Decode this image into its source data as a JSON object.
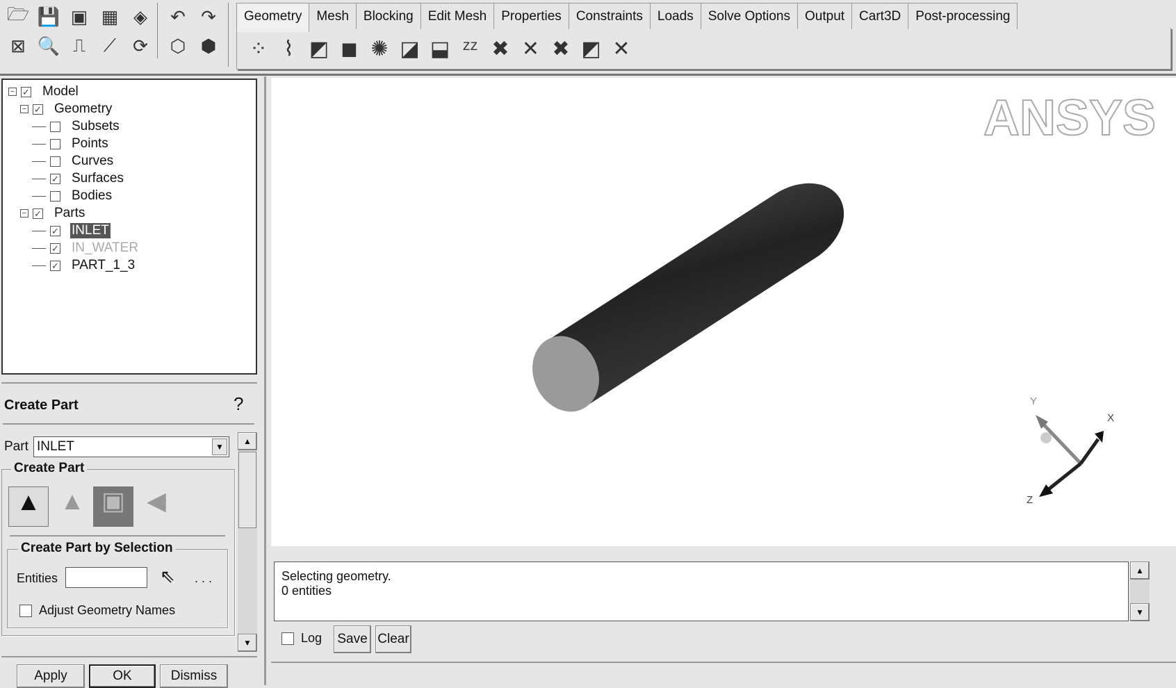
{
  "toolbar": {
    "icons_row1": [
      "open-icon",
      "save-icon",
      "save-as-icon",
      "save-project-icon",
      "import-icon",
      "undo-icon",
      "redo-icon"
    ],
    "icons_row2": [
      "fit-window-icon",
      "zoom-box-icon",
      "measure-icon",
      "coordinate-system-icon",
      "refresh-icon",
      "wireframe-icon",
      "solid-icon"
    ]
  },
  "tabs": [
    {
      "label": "Geometry",
      "active": true
    },
    {
      "label": "Mesh"
    },
    {
      "label": "Blocking"
    },
    {
      "label": "Edit Mesh"
    },
    {
      "label": "Properties"
    },
    {
      "label": "Constraints"
    },
    {
      "label": "Loads"
    },
    {
      "label": "Solve Options"
    },
    {
      "label": "Output"
    },
    {
      "label": "Cart3D"
    },
    {
      "label": "Post-processing"
    }
  ],
  "ribbon_icons": [
    "create-point-icon",
    "create-curve-icon",
    "create-surface-icon",
    "create-body-icon",
    "repair-geometry-icon",
    "transform-geometry-icon",
    "surface-operations-icon",
    "zzz-icon",
    "delete-point-icon",
    "delete-curve-icon",
    "delete-surface-icon",
    "delete-body-icon",
    "delete-any-icon"
  ],
  "tree": {
    "items": [
      {
        "label": "Model",
        "level": 0,
        "checked": true,
        "expand": true
      },
      {
        "label": "Geometry",
        "level": 1,
        "checked": true,
        "expand": true
      },
      {
        "label": "Subsets",
        "level": 2,
        "checked": false
      },
      {
        "label": "Points",
        "level": 2,
        "checked": false
      },
      {
        "label": "Curves",
        "level": 2,
        "checked": false
      },
      {
        "label": "Surfaces",
        "level": 2,
        "checked": true
      },
      {
        "label": "Bodies",
        "level": 2,
        "checked": false
      },
      {
        "label": "Parts",
        "level": 1,
        "checked": true,
        "expand": true
      },
      {
        "label": "INLET",
        "level": 2,
        "checked": true,
        "selected": true
      },
      {
        "label": "IN_WATER",
        "level": 2,
        "checked": true,
        "dimmed": true
      },
      {
        "label": "PART_1_3",
        "level": 2,
        "checked": true
      }
    ]
  },
  "panel": {
    "title": "Create Part",
    "part_label": "Part",
    "part_value": "INLET",
    "group1": "Create Part",
    "group2": "Create Part by Selection",
    "entities_label": "Entities",
    "entities_value": "",
    "ellipsis": ". . .",
    "adjust_label": "Adjust Geometry Names",
    "adjust_checked": false,
    "apply": "Apply",
    "ok": "OK",
    "dismiss": "Dismiss"
  },
  "viewport": {
    "logo": "ANSYS",
    "axes": {
      "x": "X",
      "y": "Y",
      "z": "Z"
    }
  },
  "messages": {
    "lines": [
      "Selecting geometry.",
      "0 entities"
    ],
    "log_label": "Log",
    "log_checked": false,
    "save": "Save",
    "clear": "Clear"
  }
}
